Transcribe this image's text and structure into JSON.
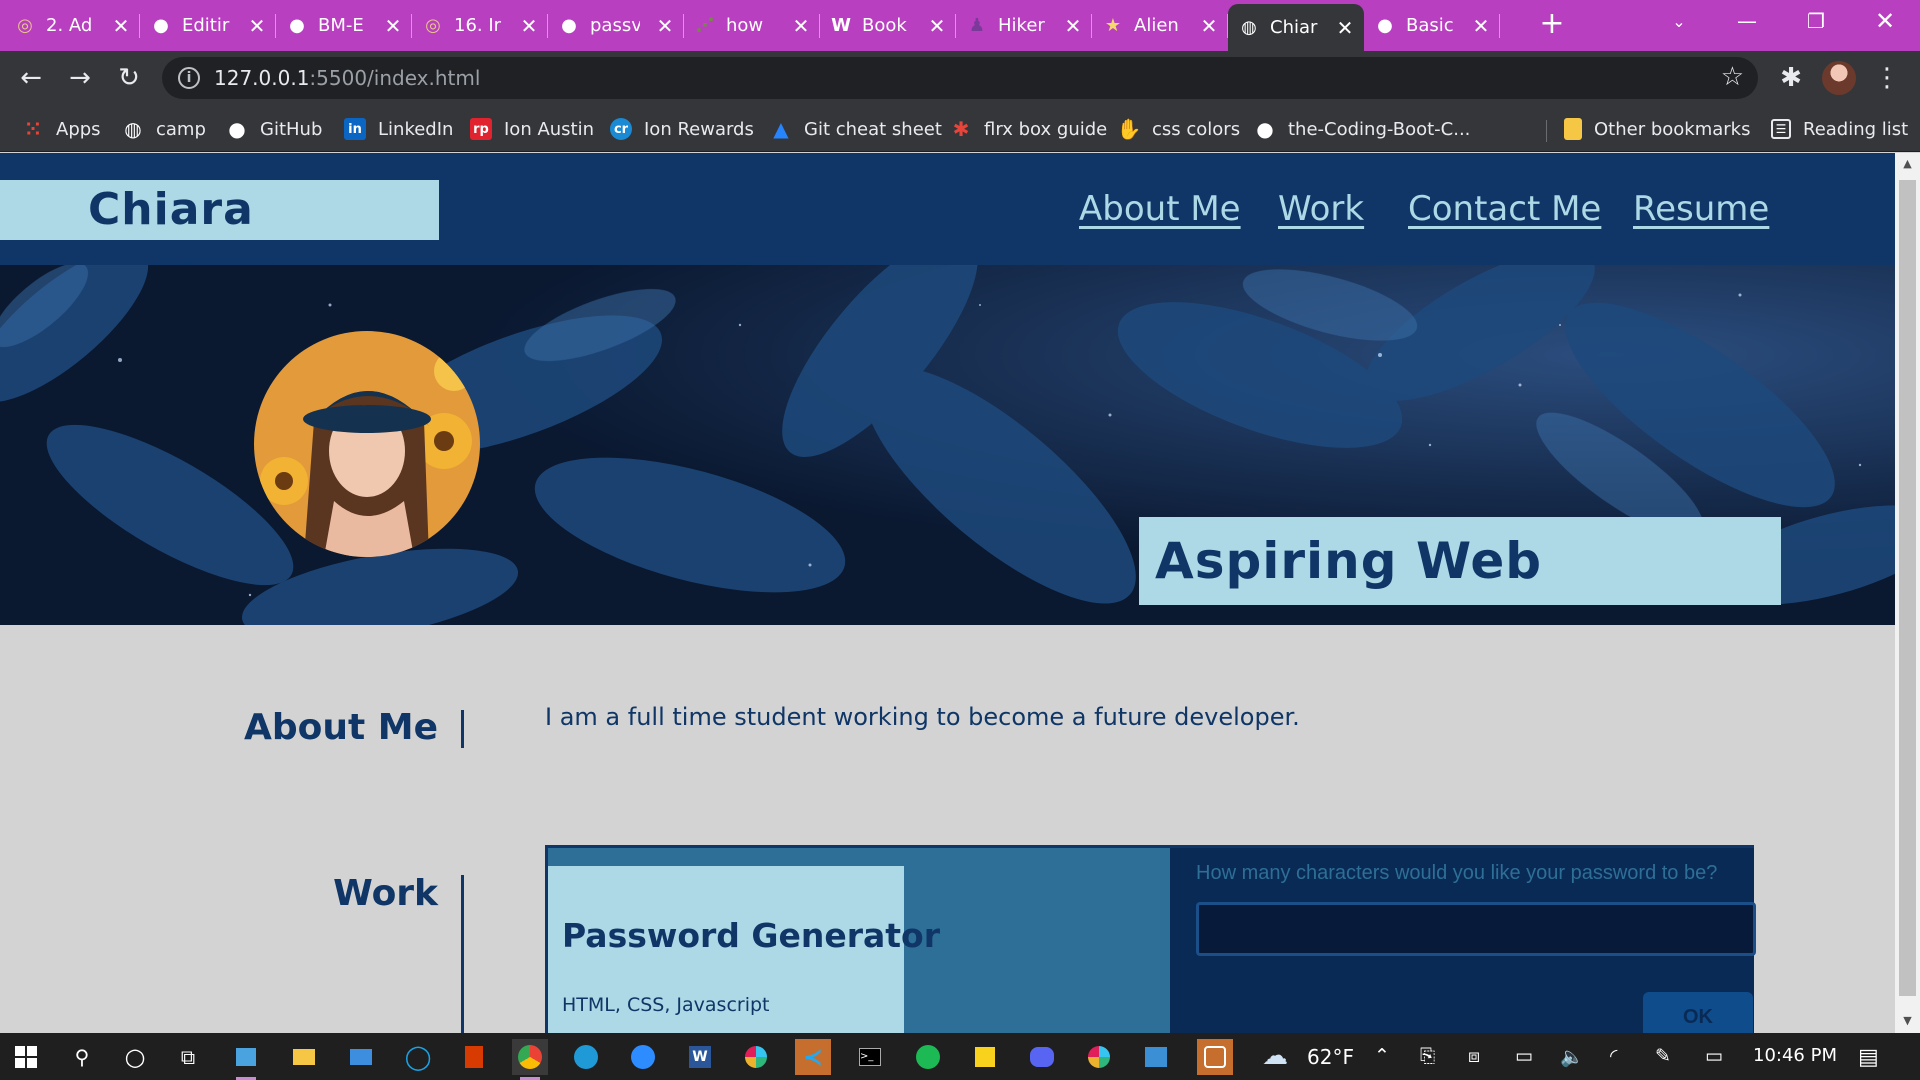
{
  "browser": {
    "tabs": [
      {
        "title": "2. Ad",
        "icon": "camp-icon",
        "color": "#e8c48a",
        "active": false
      },
      {
        "title": "Editir",
        "icon": "github-icon",
        "color": "#ffffff",
        "active": false
      },
      {
        "title": "BM-E",
        "icon": "github-icon",
        "color": "#ffffff",
        "active": false
      },
      {
        "title": "16. Ir",
        "icon": "camp-icon",
        "color": "#e8c48a",
        "active": false
      },
      {
        "title": "passv",
        "icon": "github-icon",
        "color": "#ffffff",
        "active": false
      },
      {
        "title": "how",
        "icon": "stackoverflow-icon",
        "color": "#6f8f3f",
        "active": false
      },
      {
        "title": "Book",
        "icon": "wordpress-icon",
        "color": "#ffffff",
        "active": false
      },
      {
        "title": "Hiker",
        "icon": "hiker-icon",
        "color": "#7a3a9a",
        "active": false
      },
      {
        "title": "Alien",
        "icon": "star-icon",
        "color": "#f5d76e",
        "active": false
      },
      {
        "title": "Chiar",
        "icon": "globe-icon",
        "color": "#ffffff",
        "active": true
      },
      {
        "title": "Basic",
        "icon": "github-icon",
        "color": "#ffffff",
        "active": false
      }
    ],
    "url_host": "127.0.0.1",
    "url_rest": ":5500/index.html",
    "bookmarks": [
      {
        "label": "Apps",
        "icon": "apps-grid-icon",
        "color": "#ea4335"
      },
      {
        "label": "camp",
        "icon": "globe-icon",
        "color": "#ffffff"
      },
      {
        "label": "GitHub",
        "icon": "github-icon",
        "color": "#ffffff"
      },
      {
        "label": "LinkedIn",
        "icon": "linkedin-icon",
        "color": "#0a66c2"
      },
      {
        "label": "Ion Austin",
        "icon": "rp-icon",
        "color": "#e0232e"
      },
      {
        "label": "Ion Rewards",
        "icon": "cr-icon",
        "color": "#1a8ad4"
      },
      {
        "label": "Git cheat sheet",
        "icon": "atlassian-icon",
        "color": "#2684ff"
      },
      {
        "label": "flrx box guide",
        "icon": "asterisk-icon",
        "color": "#e8443a"
      },
      {
        "label": "css colors",
        "icon": "hand-icon",
        "color": "#ffffff"
      },
      {
        "label": "the-Coding-Boot-C...",
        "icon": "github-icon",
        "color": "#ffffff"
      }
    ],
    "other_bookmarks": "Other bookmarks",
    "reading_list": "Reading list"
  },
  "site": {
    "name": "Chiara Schafer",
    "nav": [
      "About Me",
      "Work",
      "Contact Me",
      "Resume"
    ],
    "tagline": "Aspiring Web Developer",
    "about_heading": "About Me",
    "about_text": "I am a full time student working to become a future developer.",
    "work_heading": "Work",
    "project_title": "Password Generator",
    "project_tech": "HTML, CSS, Javascript",
    "prompt_label": "How many characters would you like your password to be?",
    "prompt_value": "",
    "prompt_ok": "OK"
  },
  "colors": {
    "navy": "#0f3666",
    "light_blue": "#add8e6",
    "page_bg": "#d3d3d3",
    "tab_strip": "#b83fbf"
  },
  "taskbar": {
    "weather": "62°F",
    "time": "10:46 PM"
  }
}
